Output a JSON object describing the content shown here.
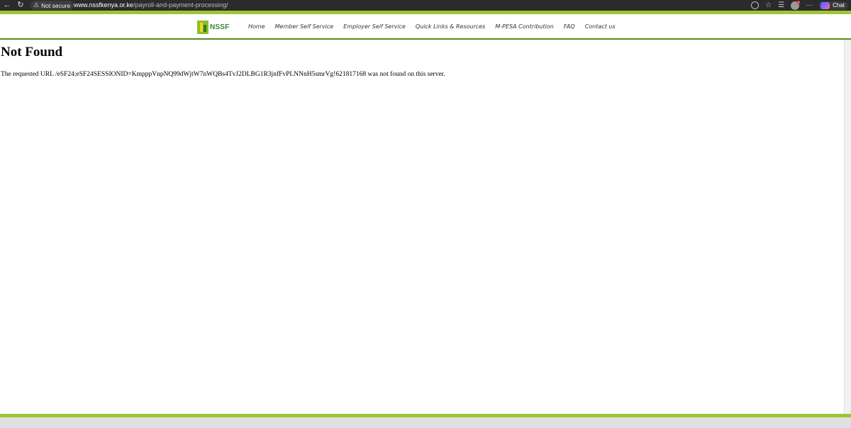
{
  "browser": {
    "back_icon": "arrow-left-icon",
    "reload_icon": "reload-icon",
    "security_label": "Not secure",
    "url_domain": "www.nssfkenya.or.ke",
    "url_path": "/payroll-and-payment-processing/",
    "more_label": "···",
    "chat_label": "Chat"
  },
  "site": {
    "logo_text": "NSSF",
    "nav": [
      {
        "label": "Home"
      },
      {
        "label": "Member Self Service"
      },
      {
        "label": "Employer Self Service"
      },
      {
        "label": "Quick Links & Resources"
      },
      {
        "label": "M-PESA Contribution"
      },
      {
        "label": "FAQ"
      },
      {
        "label": "Contact us"
      }
    ],
    "colors": {
      "accent": "#9ec436",
      "dark_green": "#5a8a1c",
      "logo_green": "#2d8a34"
    }
  },
  "content": {
    "title": "Not Found",
    "message": "The requested URL /eSF24;eSF24SESSIONID=KmpppVnpNQ99dWjtW7nWQBs4TvJ2DLBG1R3jnfFvPLNNnH5smrVg!621817168 was not found on this server."
  }
}
